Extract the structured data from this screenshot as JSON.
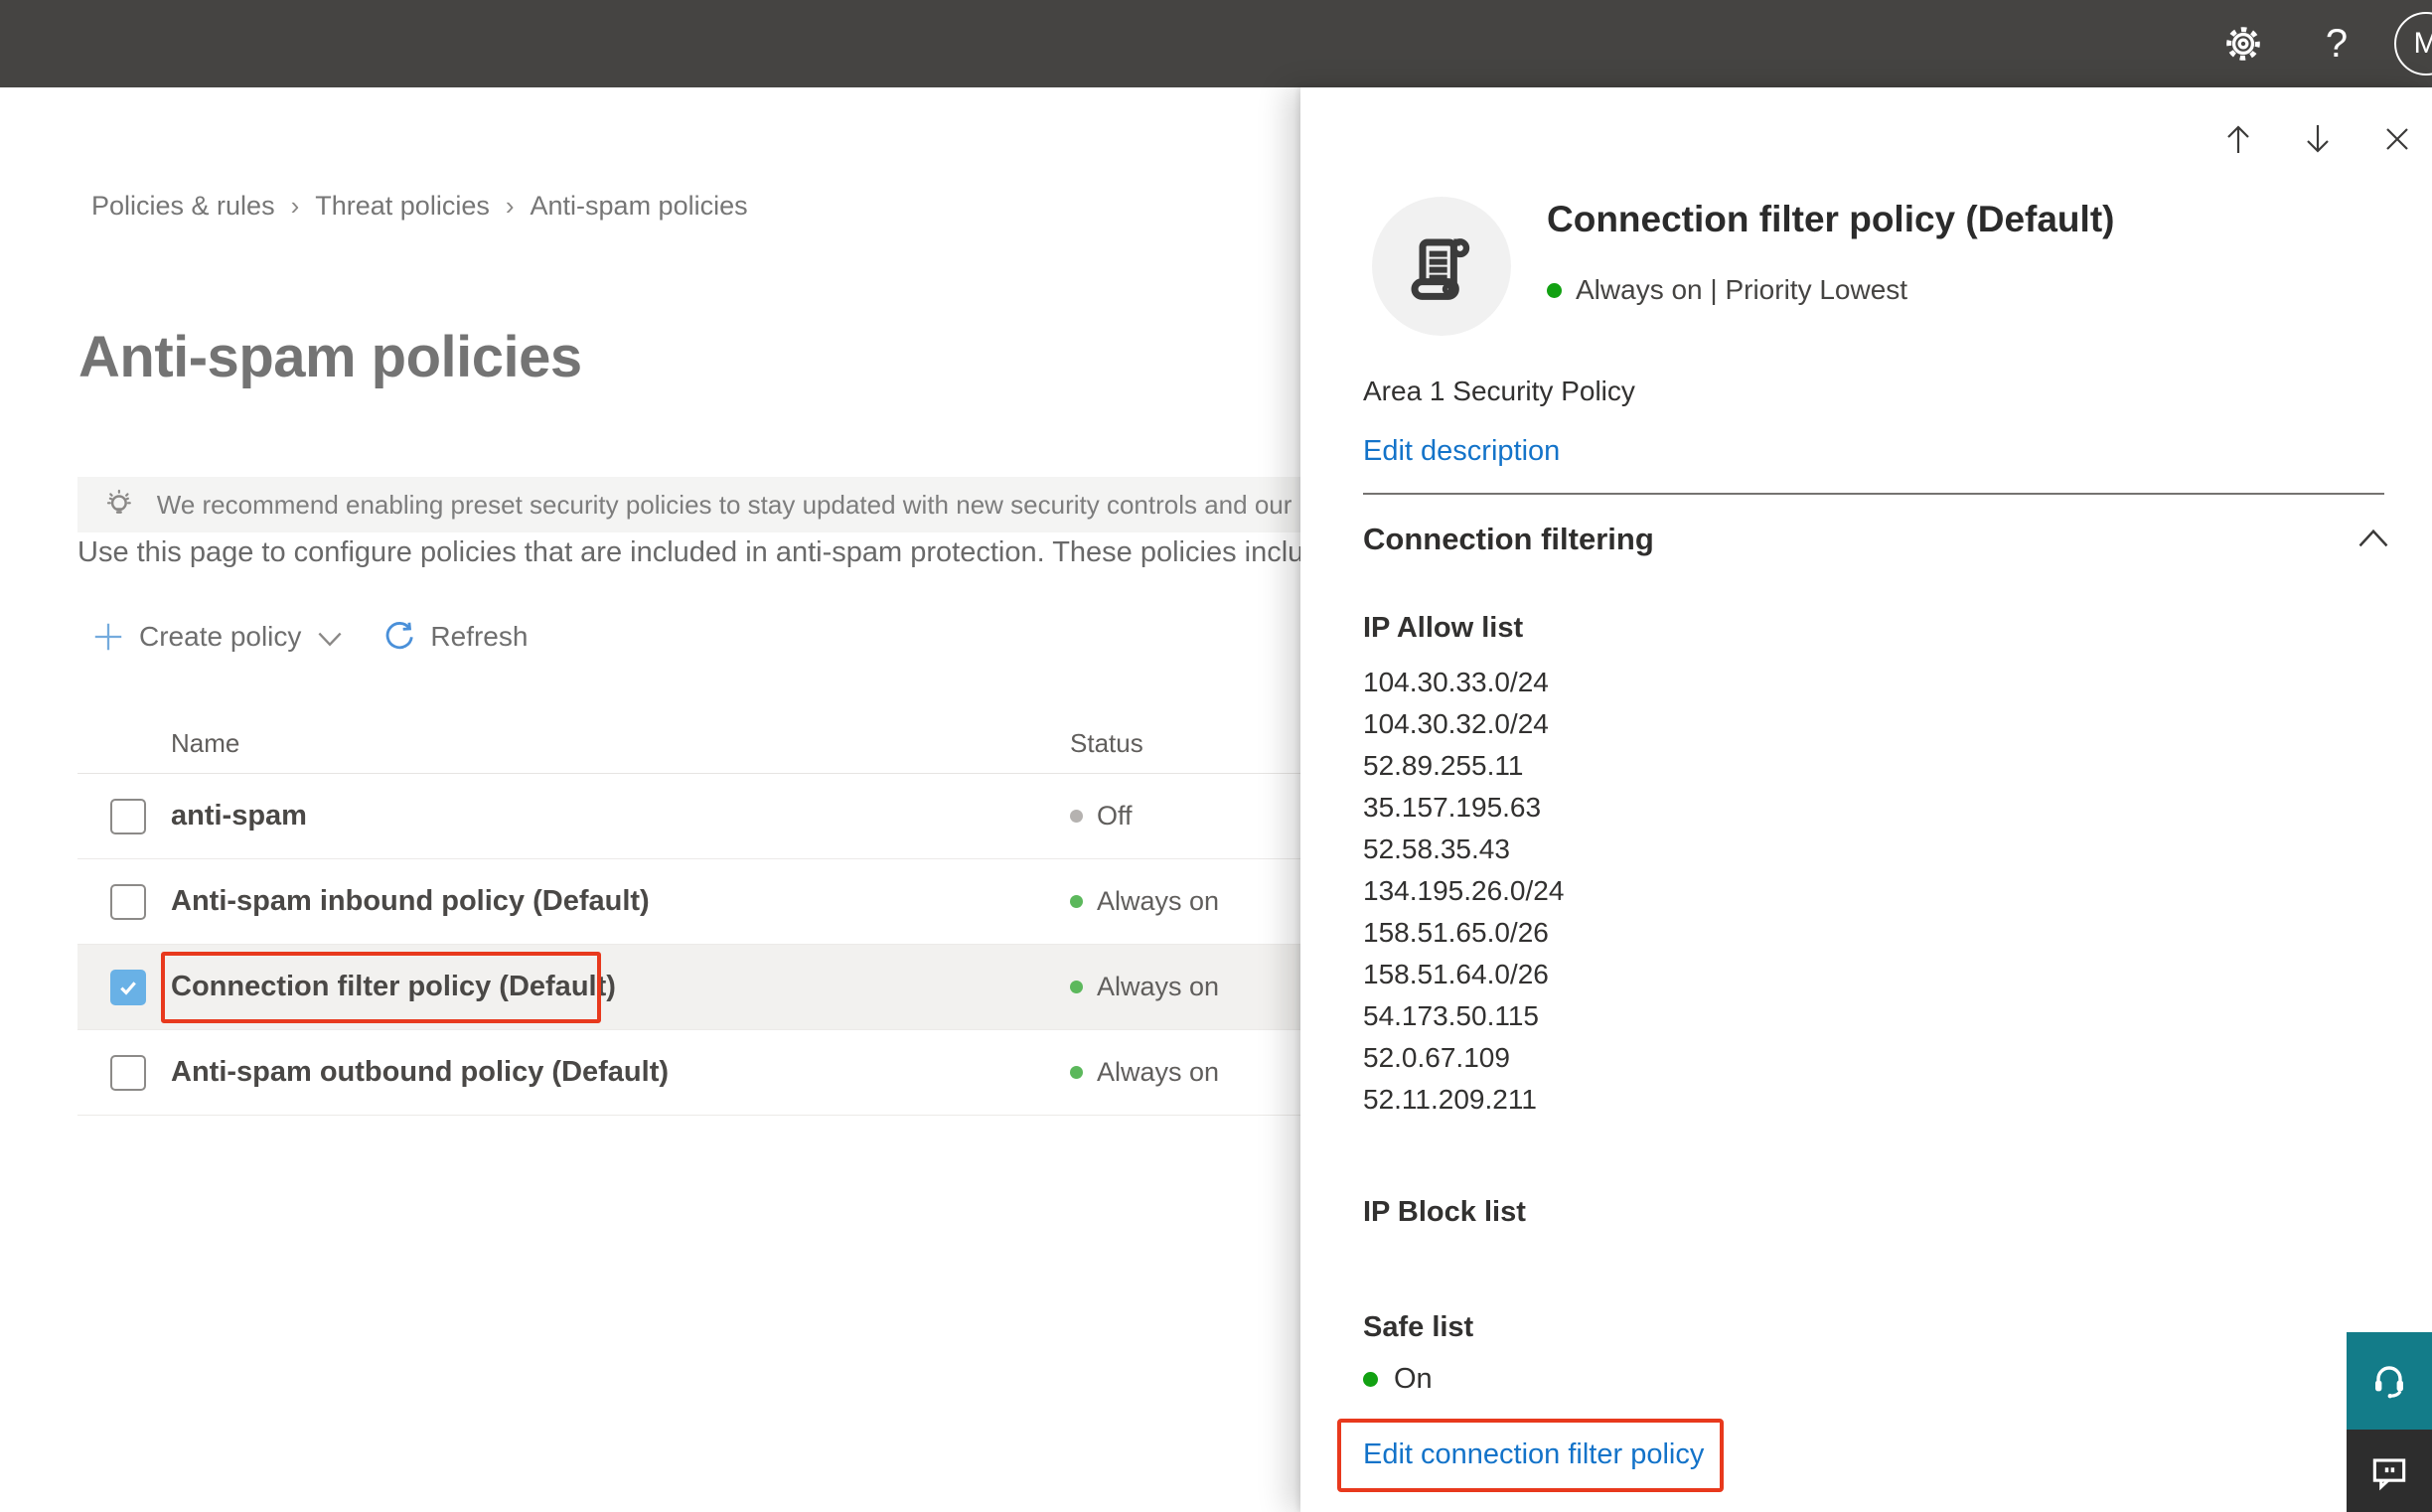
{
  "topbar": {
    "avatar_initial": "M"
  },
  "breadcrumb": {
    "items": [
      "Policies & rules",
      "Threat policies",
      "Anti-spam policies"
    ],
    "separator": "›"
  },
  "page": {
    "title": "Anti-spam policies",
    "banner": "We recommend enabling preset security policies to stay updated with new security controls and our recomme",
    "intro": "Use this page to configure policies that are included in anti-spam protection. These policies include",
    "toolbar": {
      "create": "Create policy",
      "refresh": "Refresh"
    },
    "table": {
      "columns": {
        "name": "Name",
        "status": "Status"
      },
      "rows": [
        {
          "name": "anti-spam",
          "status": "Off",
          "state": "off",
          "checked": false
        },
        {
          "name": "Anti-spam inbound policy (Default)",
          "status": "Always on",
          "state": "on",
          "checked": false
        },
        {
          "name": "Connection filter policy (Default)",
          "status": "Always on",
          "state": "on",
          "checked": true
        },
        {
          "name": "Anti-spam outbound policy (Default)",
          "status": "Always on",
          "state": "on",
          "checked": false
        }
      ]
    }
  },
  "panel": {
    "title": "Connection filter policy (Default)",
    "status_text": "Always on | Priority Lowest",
    "description": "Area 1 Security Policy",
    "edit_description_label": "Edit description",
    "section_title": "Connection filtering",
    "ip_allow_label": "IP Allow list",
    "ip_allow": [
      "104.30.33.0/24",
      "104.30.32.0/24",
      "52.89.255.11",
      "35.157.195.63",
      "52.58.35.43",
      "134.195.26.0/24",
      "158.51.65.0/26",
      "158.51.64.0/26",
      "54.173.50.115",
      "52.0.67.109",
      "52.11.209.211"
    ],
    "ip_block_label": "IP Block list",
    "safe_list_label": "Safe list",
    "safe_list_value": "On",
    "edit_policy_label": "Edit connection filter policy"
  },
  "colors": {
    "topbar_bg": "#454442",
    "link_blue": "#1373c9",
    "status_on_green": "#5cb85c",
    "panel_green": "#12a112",
    "status_off_gray": "#b5b2b0",
    "highlight_red": "#e8391d",
    "checkbox_checked_blue": "#69b1e6",
    "selected_row_bg": "#f2f1ef",
    "support_teal": "#137c89",
    "feedback_dark": "#2d2d2d"
  }
}
